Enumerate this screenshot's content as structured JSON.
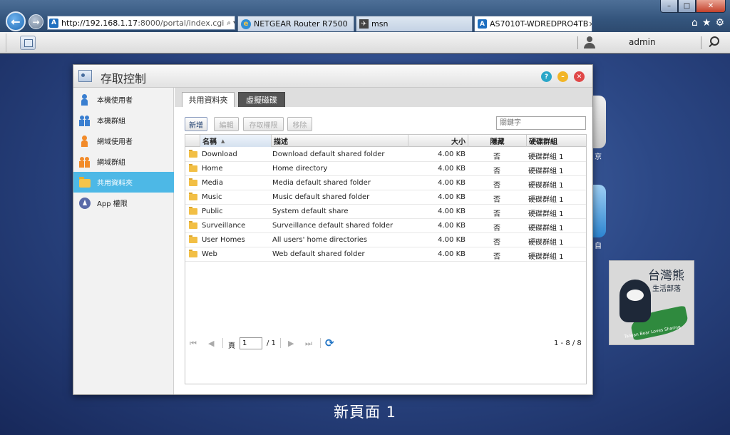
{
  "browser": {
    "address": {
      "host": "http://192.168.1.17",
      "path": ":8000/portal/index.cgi",
      "controls": "⌕ ▾ ↻"
    },
    "tabs": [
      {
        "label": "NETGEAR Router R7500"
      },
      {
        "label": "msn"
      },
      {
        "label": "AS7010T-WDREDPRO4TB"
      }
    ],
    "tab_close": "×",
    "window_controls": {
      "minimize": "–",
      "maximize": "□",
      "close": "✕"
    }
  },
  "topbar": {
    "username": "admin"
  },
  "window": {
    "title": "存取控制",
    "controls": {
      "help": "?",
      "minimize": "–",
      "close": "✕"
    }
  },
  "sidebar": {
    "items": [
      {
        "label": "本機使用者"
      },
      {
        "label": "本機群組"
      },
      {
        "label": "網域使用者"
      },
      {
        "label": "網域群組"
      },
      {
        "label": "共用資料夾"
      },
      {
        "label": "App 權限"
      }
    ]
  },
  "content": {
    "tabs": [
      {
        "label": "共用資料夾"
      },
      {
        "label": "虛擬磁碟"
      }
    ],
    "toolbar": {
      "new": "新增",
      "edit": "編輯",
      "permission": "存取權限",
      "remove": "移除"
    },
    "search": {
      "placeholder": "關鍵字"
    },
    "table": {
      "headers": {
        "name": "名稱",
        "desc": "描述",
        "size": "大小",
        "hidden": "隱藏",
        "group": "硬碟群組"
      },
      "rows": [
        {
          "name": "Download",
          "desc": "Download default shared folder",
          "size": "4.00 KB",
          "hidden": "否",
          "group": "硬碟群組 1"
        },
        {
          "name": "Home",
          "desc": "Home directory",
          "size": "4.00 KB",
          "hidden": "否",
          "group": "硬碟群組 1"
        },
        {
          "name": "Media",
          "desc": "Media default shared folder",
          "size": "4.00 KB",
          "hidden": "否",
          "group": "硬碟群組 1"
        },
        {
          "name": "Music",
          "desc": "Music default shared folder",
          "size": "4.00 KB",
          "hidden": "否",
          "group": "硬碟群組 1"
        },
        {
          "name": "Public",
          "desc": "System default share",
          "size": "4.00 KB",
          "hidden": "否",
          "group": "硬碟群組 1"
        },
        {
          "name": "Surveillance",
          "desc": "Surveillance default shared folder",
          "size": "4.00 KB",
          "hidden": "否",
          "group": "硬碟群組 1"
        },
        {
          "name": "User Homes",
          "desc": "All users' home directories",
          "size": "4.00 KB",
          "hidden": "否",
          "group": "硬碟群組 1"
        },
        {
          "name": "Web",
          "desc": "Web default shared folder",
          "size": "4.00 KB",
          "hidden": "否",
          "group": "硬碟群組 1"
        }
      ]
    },
    "pager": {
      "first": "⏮",
      "prev": "◀",
      "page_label": "頁",
      "page_value": "1",
      "total": "/ 1",
      "next": "▶",
      "last": "⏭",
      "refresh": "⟳",
      "range": "1 - 8 / 8"
    }
  },
  "desktop": {
    "page_label": "新頁面 1",
    "side_labels": [
      "京",
      "自"
    ],
    "watermark": {
      "title": "台灣熊",
      "subtitle": "生活部落",
      "en": "Taiwan Bear Loves Sharing"
    }
  },
  "colors": {
    "selected": "#4db8e6",
    "accent": "#1f73c4"
  }
}
